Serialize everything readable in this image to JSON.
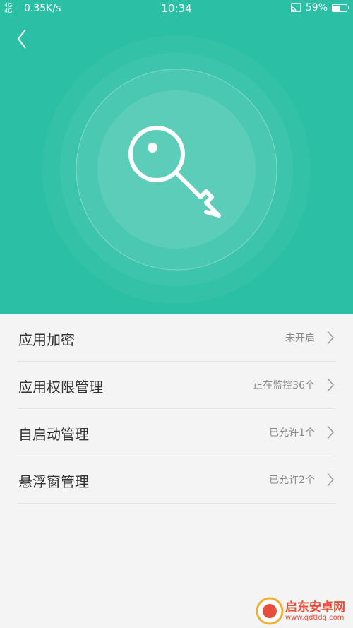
{
  "statusbar": {
    "network": "4G 4G",
    "speed": "0.35K/s",
    "time": "10:34",
    "battery": "59%",
    "battery_level": 0.59
  },
  "header": {
    "icon": "key-icon",
    "bg_color": "#2bbfa5"
  },
  "menu": [
    {
      "label": "应用加密",
      "status": "未开启"
    },
    {
      "label": "应用权限管理",
      "status": "正在监控36个"
    },
    {
      "label": "自启动管理",
      "status": "已允许1个"
    },
    {
      "label": "悬浮窗管理",
      "status": "已允许2个"
    }
  ],
  "watermark": {
    "name": "启东安卓网",
    "url": "www.qdtldq.com"
  }
}
